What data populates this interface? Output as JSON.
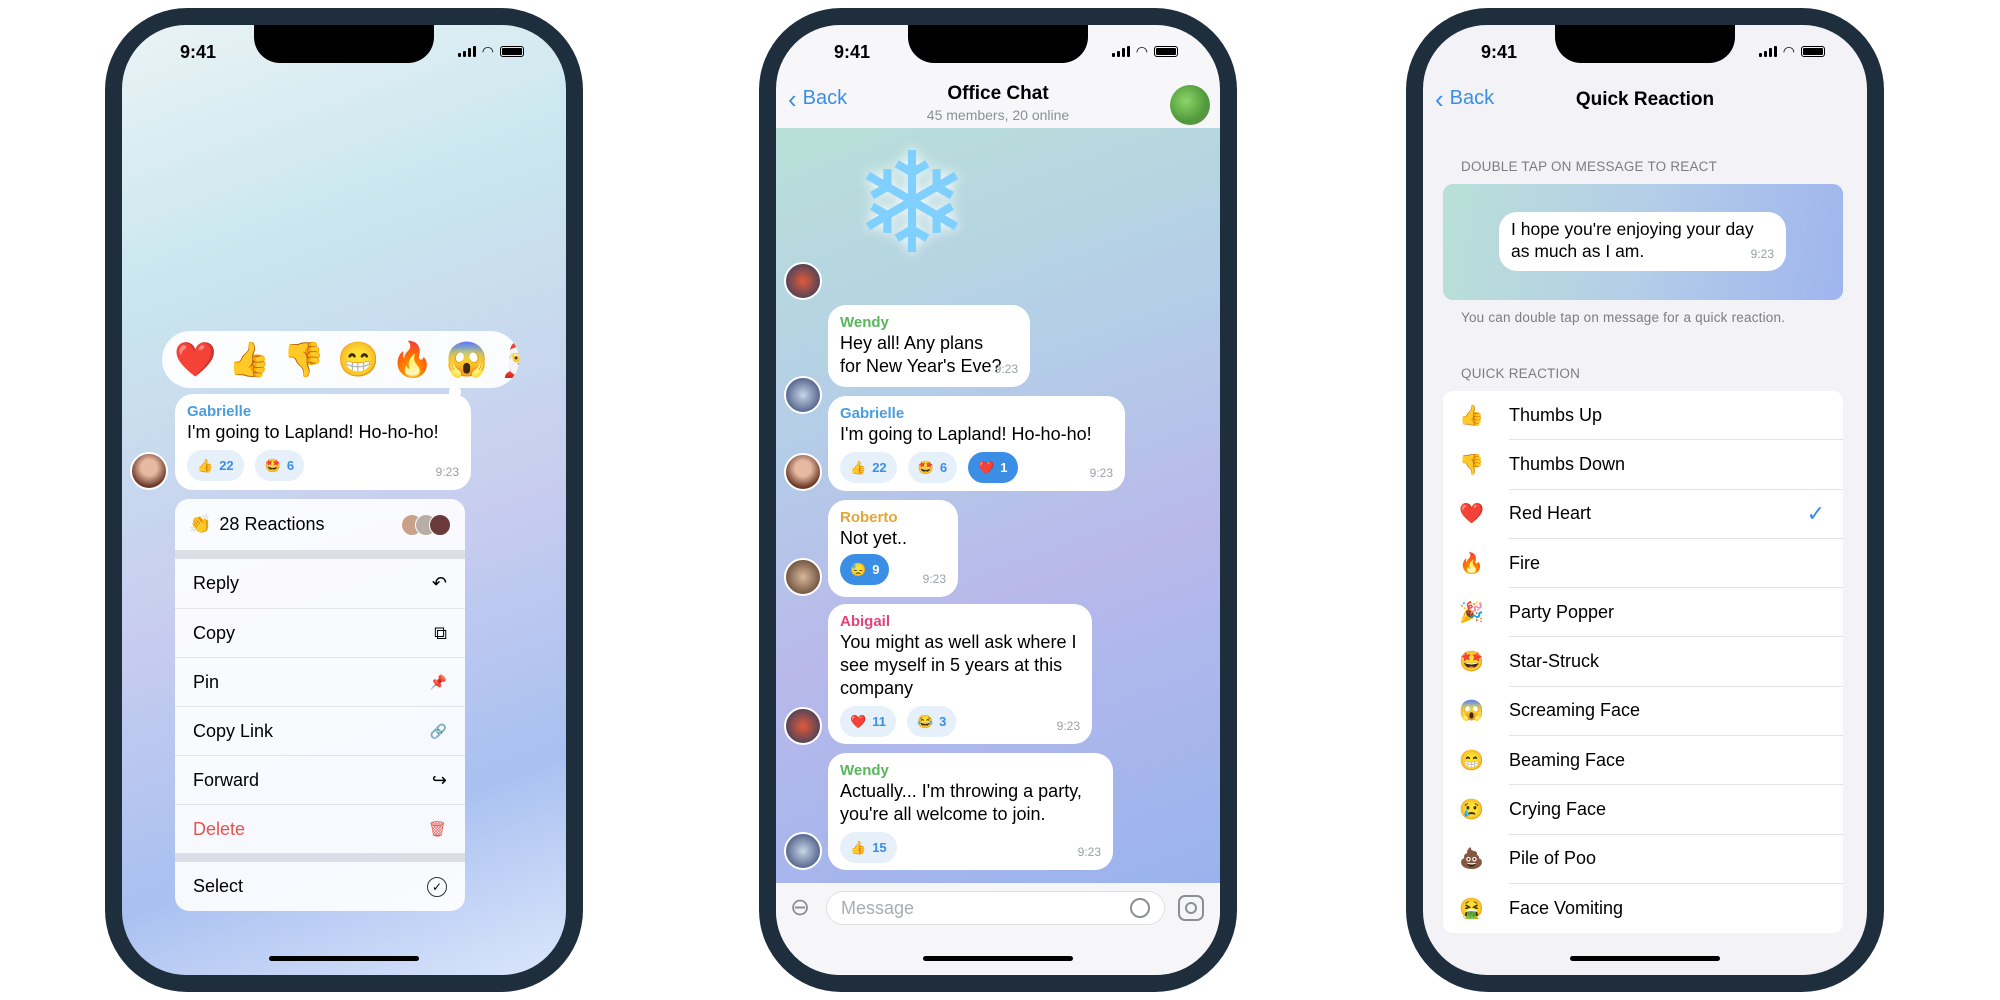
{
  "status_time": "9:41",
  "colors": {
    "accent": "#3a8ee6",
    "frame": "#1f2e3d",
    "delete": "#e5534b",
    "wendy": "#57b85b",
    "gabrielle": "#4a9de0",
    "roberto": "#e3a53a",
    "abigail": "#e0457b"
  },
  "phone1": {
    "reaction_bar": [
      "❤️",
      "👍",
      "👎",
      "😁",
      "🔥",
      "😱",
      "🎅"
    ],
    "message": {
      "sender": "Gabrielle",
      "text": "I'm going to Lapland! Ho-ho-ho!",
      "time": "9:23",
      "reactions": [
        {
          "emoji": "👍",
          "count": "22"
        },
        {
          "emoji": "🤩",
          "count": "6"
        }
      ]
    },
    "reactions_summary": {
      "icon": "clapping-hands-icon",
      "glyph": "👏",
      "label": "28 Reactions"
    },
    "menu": [
      {
        "label": "Reply",
        "icon": "reply-icon",
        "glyph": "↶"
      },
      {
        "label": "Copy",
        "icon": "copy-icon",
        "glyph": "⧉"
      },
      {
        "label": "Pin",
        "icon": "pin-icon",
        "glyph": "📌"
      },
      {
        "label": "Copy Link",
        "icon": "link-icon",
        "glyph": "🔗"
      },
      {
        "label": "Forward",
        "icon": "forward-icon",
        "glyph": "↪"
      },
      {
        "label": "Delete",
        "icon": "trash-icon",
        "glyph": "🗑"
      }
    ],
    "select": {
      "label": "Select",
      "icon": "check-circle-icon",
      "glyph": "✓"
    }
  },
  "phone2": {
    "back": "Back",
    "title": "Office Chat",
    "subtitle": "45 members, 20 online",
    "messages": [
      {
        "sender": "Wendy",
        "text": "Hey all! Any plans for New Year's Eve?",
        "time": "9:23",
        "reactions": []
      },
      {
        "sender": "Gabrielle",
        "text": "I'm going to Lapland! Ho-ho-ho!",
        "time": "9:23",
        "reactions": [
          {
            "emoji": "👍",
            "count": "22"
          },
          {
            "emoji": "🤩",
            "count": "6"
          },
          {
            "emoji": "❤️",
            "count": "1",
            "selected": true
          }
        ]
      },
      {
        "sender": "Roberto",
        "text": "Not yet..",
        "time": "9:23",
        "reactions": [
          {
            "emoji": "😓",
            "count": "9",
            "selected": true
          }
        ]
      },
      {
        "sender": "Abigail",
        "text": "You might as well ask where I see myself in 5 years at this company",
        "time": "9:23",
        "reactions": [
          {
            "emoji": "❤️",
            "count": "11"
          },
          {
            "emoji": "😂",
            "count": "3"
          }
        ]
      },
      {
        "sender": "Wendy",
        "text": "Actually... I'm throwing a party, you're all welcome to join.",
        "time": "9:23",
        "reactions": [
          {
            "emoji": "👍",
            "count": "15"
          }
        ]
      }
    ],
    "input_placeholder": "Message"
  },
  "phone3": {
    "back": "Back",
    "title": "Quick Reaction",
    "section1": "DOUBLE TAP ON MESSAGE TO REACT",
    "preview": {
      "text": "I hope you're enjoying your day as much as I am.",
      "time": "9:23"
    },
    "footnote": "You can double tap on message for a quick reaction.",
    "section2": "QUICK REACTION",
    "options": [
      {
        "emoji": "👍",
        "label": "Thumbs Up"
      },
      {
        "emoji": "👎",
        "label": "Thumbs Down"
      },
      {
        "emoji": "❤️",
        "label": "Red Heart",
        "selected": true
      },
      {
        "emoji": "🔥",
        "label": "Fire"
      },
      {
        "emoji": "🎉",
        "label": "Party Popper"
      },
      {
        "emoji": "🤩",
        "label": "Star-Struck"
      },
      {
        "emoji": "😱",
        "label": "Screaming Face"
      },
      {
        "emoji": "😁",
        "label": "Beaming Face"
      },
      {
        "emoji": "😢",
        "label": "Crying Face"
      },
      {
        "emoji": "💩",
        "label": "Pile of Poo"
      },
      {
        "emoji": "🤮",
        "label": "Face Vomiting"
      }
    ],
    "check": "✓"
  }
}
